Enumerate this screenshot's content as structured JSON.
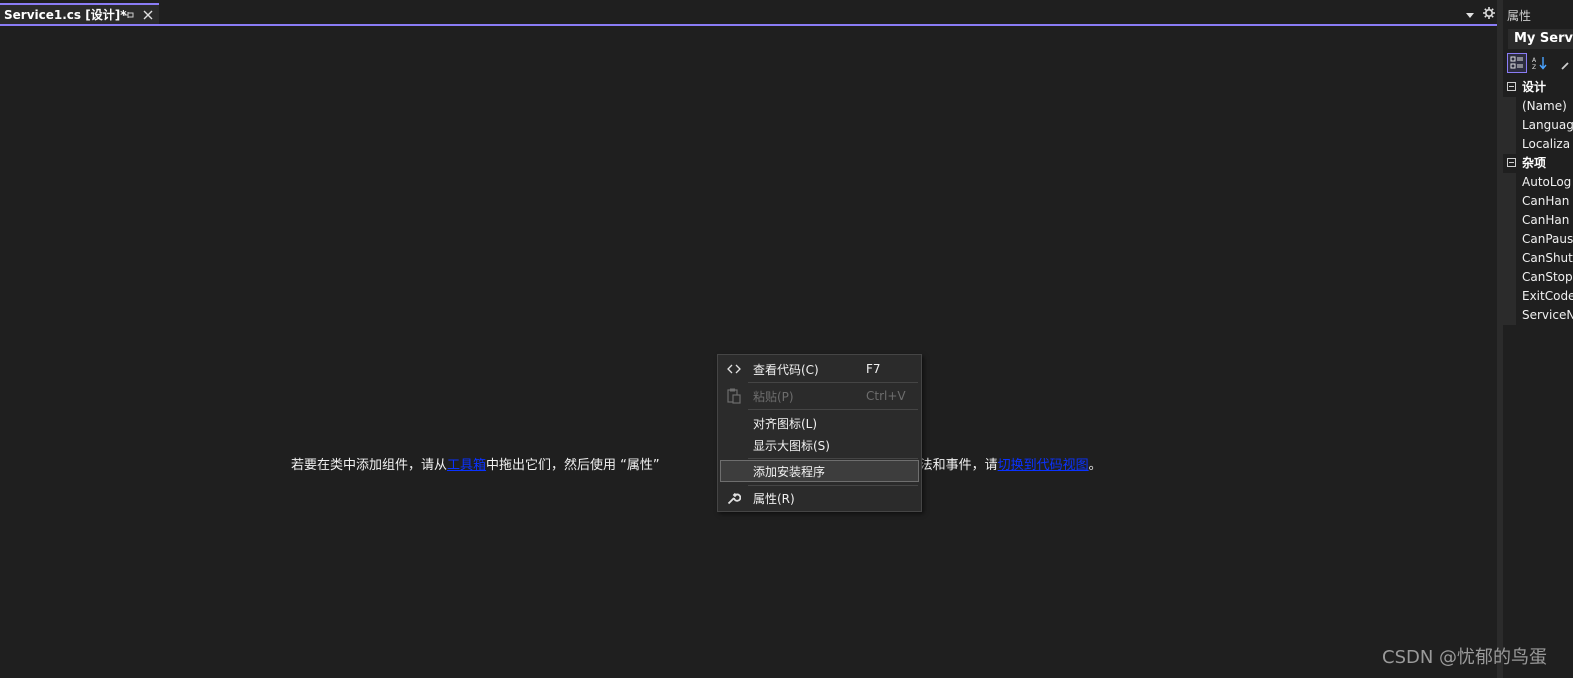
{
  "editor": {
    "tab_title": "Service1.cs [设计]*",
    "pin_icon": "pin-icon",
    "close_icon": "close-icon",
    "hint": {
      "before": "若要在类中添加组件，请从",
      "toolbox_link": "工具箱",
      "middle": "中拖出它们，然后使用 “属性”",
      "after": "为类创建方法和事件，请",
      "code_view_link": "切换到代码视图",
      "end": "。"
    }
  },
  "context_menu": {
    "items": [
      {
        "label": "查看代码(C)",
        "shortcut": "F7",
        "icon": "code-icon"
      },
      {
        "label": "粘贴(P)",
        "shortcut": "Ctrl+V",
        "icon": "paste-icon"
      },
      {
        "label": "对齐图标(L)"
      },
      {
        "label": "显示大图标(S)"
      },
      {
        "label": "添加安装程序"
      },
      {
        "label": "属性(R)",
        "icon": "wrench-icon"
      }
    ]
  },
  "properties": {
    "title": "属性",
    "object": "My Servic",
    "categories": [
      {
        "name": "设计",
        "props": [
          "(Name)",
          "Languag",
          "Localiza"
        ]
      },
      {
        "name": "杂项",
        "props": [
          "AutoLog",
          "CanHan",
          "CanHan",
          "CanPaus",
          "CanShut",
          "CanStop",
          "ExitCode",
          "ServiceN"
        ]
      }
    ]
  },
  "watermark": "CSDN @忧郁的鸟蛋",
  "colors": {
    "accent": "#8a7cf5",
    "background": "#1f1f1f",
    "link": "#0a32ff"
  }
}
